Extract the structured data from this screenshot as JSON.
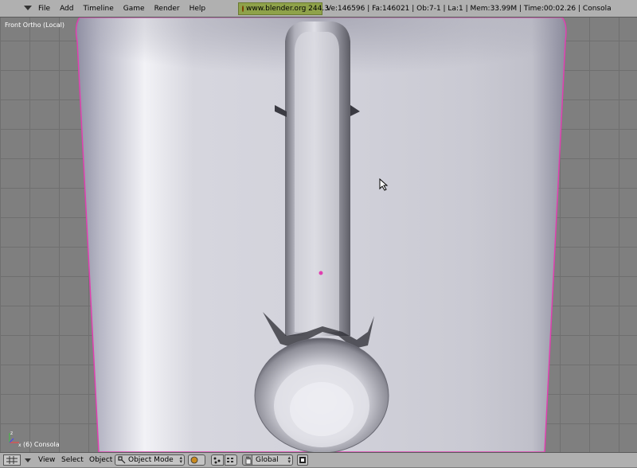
{
  "top_header": {
    "menus": [
      "File",
      "Add",
      "Timeline",
      "Game",
      "Render",
      "Help"
    ],
    "weblink": "www.blender.org 244.3",
    "stats": "Ve:146596 | Fa:146021 | Ob:7-1 | La:1  | Mem:33.99M  | Time:00:02.26 | Consola"
  },
  "viewport": {
    "view_label": "Front Ortho (Local)",
    "object_label": "(6) Consola"
  },
  "bottom_header": {
    "menus": [
      "View",
      "Select",
      "Object"
    ],
    "mode": "Object Mode",
    "orientation": "Global"
  },
  "colors": {
    "header_bg": "#b0b0b0",
    "viewport_bg": "#7f7f7f",
    "grid": "#6f6f6f",
    "weblink_bg": "#8fa24a",
    "selection_outline": "#e040b0"
  },
  "icons": [
    "menu-arrow-icon",
    "blender-logo-icon",
    "grid-view-icon",
    "object-mode-icon",
    "shading-icon",
    "pivot-icon",
    "hand-icon",
    "render-icon",
    "axes-icon",
    "mouse-cursor-icon"
  ]
}
